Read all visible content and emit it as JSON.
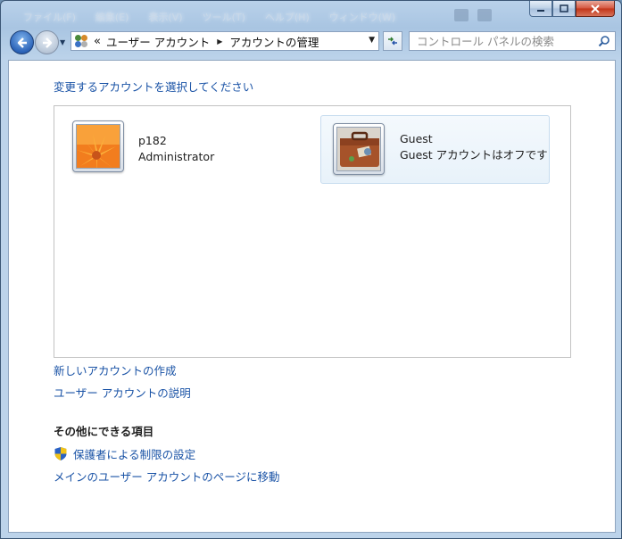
{
  "menu": {
    "items": [
      "ファイル(F)",
      "編集(E)",
      "表示(V)",
      "ツール(T)",
      "ヘルプ(H)",
      "ウィンドウ(W)"
    ]
  },
  "address": {
    "overflow": "«",
    "crumbs": [
      "ユーザー アカウント",
      "アカウントの管理"
    ]
  },
  "search": {
    "placeholder": "コントロール パネルの検索"
  },
  "content": {
    "heading": "変更するアカウントを選択してください",
    "accounts": [
      {
        "name": "p182",
        "detail": "Administrator",
        "picture": "flower"
      },
      {
        "name": "Guest",
        "detail": "Guest アカウントはオフです",
        "picture": "suitcase"
      }
    ],
    "links": {
      "create": "新しいアカウントの作成",
      "about": "ユーザー アカウントの説明"
    },
    "other_section": {
      "title": "その他にできる項目",
      "parental": "保護者による制限の設定",
      "main_page": "メインのユーザー アカウントのページに移動"
    }
  },
  "icons": [
    "back-arrow-icon",
    "forward-arrow-icon",
    "user-accounts-icon",
    "refresh-icon",
    "search-icon",
    "uac-shield-icon"
  ],
  "colors": {
    "link": "#1a53a6",
    "frame": "#b9d1ea",
    "close": "#c23418"
  }
}
